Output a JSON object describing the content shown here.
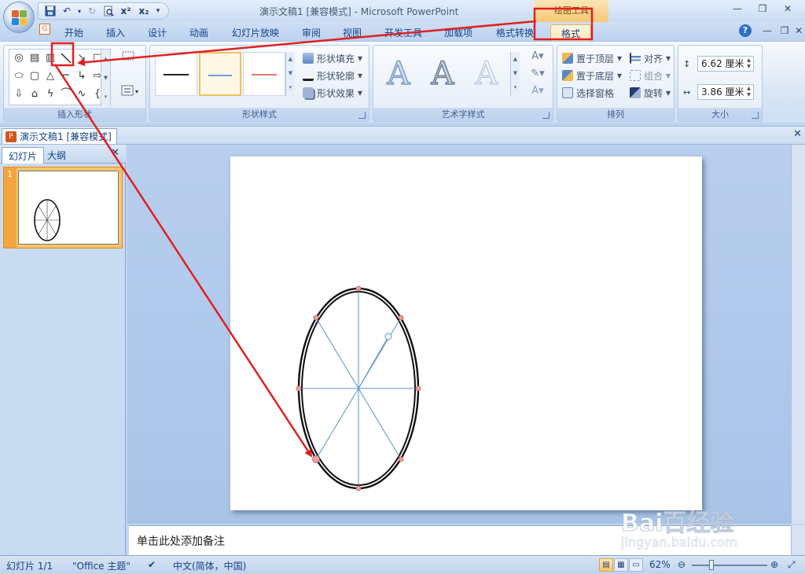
{
  "app": {
    "title": "演示文稿1 [兼容模式] - Microsoft PowerPoint",
    "context_tab_group": "绘图工具",
    "accent": "#e02020"
  },
  "qat": {
    "superscript": "x²",
    "subscript": "x₂"
  },
  "tabs": [
    {
      "label": "开始"
    },
    {
      "label": "插入"
    },
    {
      "label": "设计"
    },
    {
      "label": "动画"
    },
    {
      "label": "幻灯片放映"
    },
    {
      "label": "审阅"
    },
    {
      "label": "视图"
    },
    {
      "label": "开发工具"
    },
    {
      "label": "加载项"
    },
    {
      "label": "格式转换"
    },
    {
      "label": "格式"
    }
  ],
  "ribbon": {
    "groups": {
      "insert_shapes": "插入形状",
      "shape_styles": "形状样式",
      "wordart_styles": "艺术字样式",
      "arrange": "排列",
      "size": "大小"
    },
    "shape_style_menu": {
      "fill": "形状填充",
      "outline": "形状轮廓",
      "effects": "形状效果"
    },
    "wordart_letter": "A",
    "arrange_menu": {
      "bring_front": "置于顶层",
      "send_back": "置于底层",
      "selection_pane": "选择窗格",
      "align": "对齐",
      "group": "组合",
      "rotate": "旋转"
    },
    "size": {
      "height": "6.62 厘米",
      "width": "3.86 厘米"
    }
  },
  "document_tab": "演示文稿1 [兼容模式]",
  "left_pane": {
    "tabs": [
      {
        "label": "幻灯片"
      },
      {
        "label": "大纲"
      }
    ],
    "slide_number": "1"
  },
  "notes": {
    "placeholder": "单击此处添加备注"
  },
  "status": {
    "slide": "幻灯片 1/1",
    "theme": "\"Office 主题\"",
    "language": "中文(简体，中国)",
    "zoom": "62%"
  },
  "watermark": {
    "main": "Bai百经验",
    "sub": "jingyan.baidu.com"
  }
}
